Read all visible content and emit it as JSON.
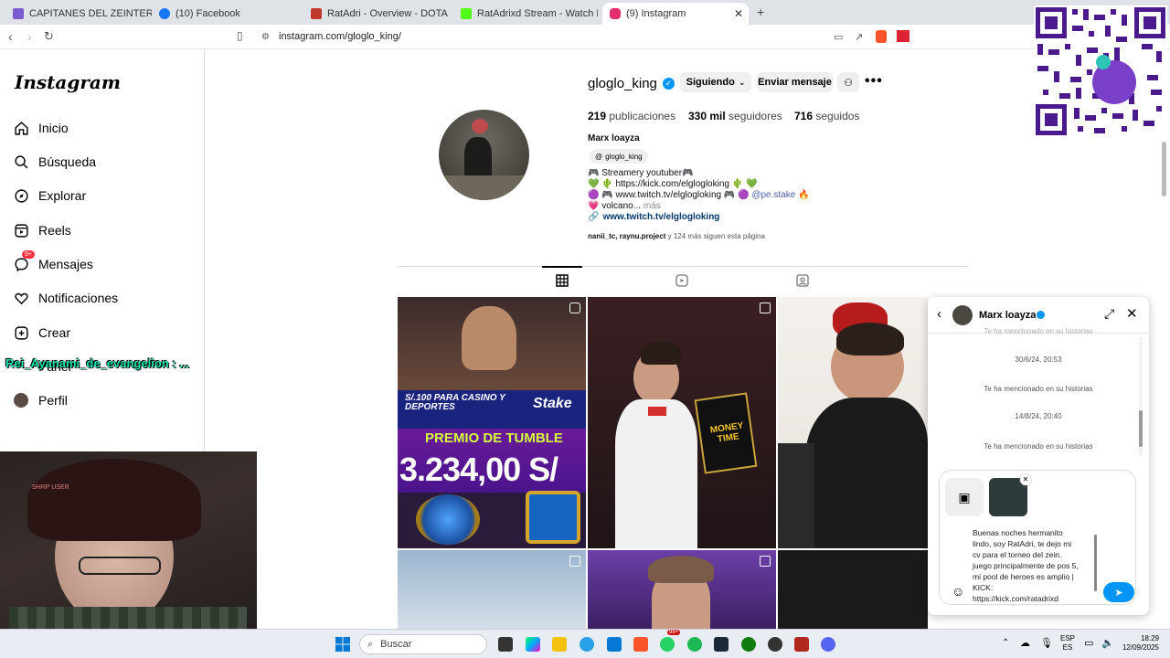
{
  "browser": {
    "tabs": [
      {
        "title": "CAPITANES DEL ZEINTERNATIONAL",
        "color": "#7a5cd0"
      },
      {
        "title": "(10) Facebook",
        "color": "#1877f2"
      },
      {
        "title": "RatAdri - Overview - DOTABUFF - Do",
        "color": "#c0392b"
      },
      {
        "title": "RatAdrixd Stream - Watch Live on Ki",
        "color": "#53fc18"
      },
      {
        "title": "(9) Instagram",
        "color": "#e1306c"
      }
    ],
    "url": "instagram.com/gloglo_king/"
  },
  "sidebar": {
    "logo": "Instagram",
    "items": [
      {
        "label": "Inicio",
        "icon": "home-icon"
      },
      {
        "label": "Búsqueda",
        "icon": "search-icon"
      },
      {
        "label": "Explorar",
        "icon": "compass-icon"
      },
      {
        "label": "Reels",
        "icon": "reels-icon"
      },
      {
        "label": "Mensajes",
        "icon": "messenger-icon",
        "badge": "9+"
      },
      {
        "label": "Notificaciones",
        "icon": "heart-icon"
      },
      {
        "label": "Crear",
        "icon": "plus-icon"
      },
      {
        "label": "Panel",
        "icon": "panel-icon"
      },
      {
        "label": "Perfil",
        "icon": "avatar-icon"
      }
    ],
    "overlay_text": "Rei_Ayanami_de_evangelion : ..."
  },
  "profile": {
    "username": "gloglo_king",
    "follow_button": "Siguiendo",
    "message_button": "Enviar mensaje",
    "posts_count": "219",
    "posts_label": "publicaciones",
    "followers_count": "330 mil",
    "followers_label": "seguidores",
    "following_count": "716",
    "following_label": "seguidos",
    "full_name": "Marx loayza",
    "threads_handle": "gloglo_king",
    "bio_lines": [
      "🎮 Streamery youtuber🎮",
      "💚 🌵 https://kick.com/elglogloking 🌵 💚",
      "🟣 🎮 www.twitch.tv/elglogloking 🎮 🟣",
      "💗 volcano..."
    ],
    "bio_mention": "@pe.stake",
    "more": "más",
    "link": "www.twitch.tv/elglogloking",
    "followed_by": "nanii_tc, raynu.project",
    "followed_by_rest": "y 124 más siguen esta página"
  },
  "grid_posts": [
    {
      "banner_top": "S/.100 PARA CASINO Y DEPORTES",
      "brand": "Stake",
      "banner_mid": "PREMIO DE TUMBLE",
      "amount": "3.234,00 S/"
    },
    {
      "overlay": "MONEY TIME"
    },
    {
      "overlay": ""
    }
  ],
  "dm": {
    "contact": "Marx loayza",
    "messages": [
      {
        "type": "text",
        "text": "Te ha mencionado en su historias"
      },
      {
        "type": "time",
        "text": "30/6/24, 20:53"
      },
      {
        "type": "text",
        "text": "Te ha mencionado en su historias"
      },
      {
        "type": "time",
        "text": "14/8/24, 20:40"
      },
      {
        "type": "text",
        "text": "Te ha mencionado en su historias"
      }
    ],
    "draft_lines": [
      "Buenas noches hermanito",
      "lindo, soy RatAdri, te dejo mi",
      "cv para el torneo del zein.",
      "juego principalmente de pos 5,",
      "mi pool de heroes es amplio |",
      "KICK:",
      "https://kick.com/ratadrixd"
    ]
  },
  "webcam": {
    "label": "SHRP USER"
  },
  "taskbar": {
    "search_placeholder": "Buscar",
    "lang_top": "ESP",
    "lang_bottom": "ES",
    "time": "18:29",
    "date": "12/09/2025",
    "badge": "99+"
  }
}
